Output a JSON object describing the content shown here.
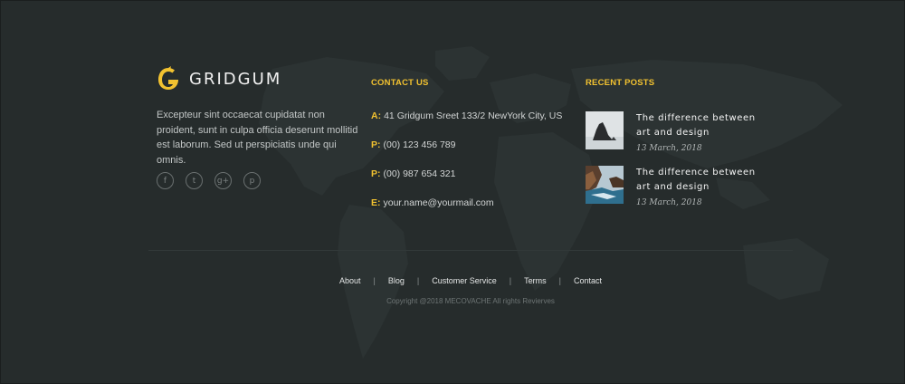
{
  "brand": {
    "name": "GRIDGUM",
    "accent": "#f2c230"
  },
  "about": {
    "text": "Excepteur sint occaecat cupidatat non proident, sunt in culpa officia deserunt mollitid est laborum. Sed ut perspiciatis unde qui omnis."
  },
  "socials": [
    {
      "icon": "facebook-icon",
      "glyph": "f"
    },
    {
      "icon": "twitter-icon",
      "glyph": "t"
    },
    {
      "icon": "google-plus-icon",
      "glyph": "g+"
    },
    {
      "icon": "pinterest-icon",
      "glyph": "p"
    }
  ],
  "contact": {
    "title": "CONTACT US",
    "address": {
      "label": "A:",
      "value": "41 Gridgum Sreet 133/2 NewYork City, US"
    },
    "phone1": {
      "label": "P:",
      "value": "(00) 123 456 789"
    },
    "phone2": {
      "label": "P:",
      "value": "(00) 987 654 321"
    },
    "email": {
      "label": "E:",
      "value": "your.name@yourmail.com"
    }
  },
  "recent_posts": {
    "title": "RECENT POSTS",
    "items": [
      {
        "title": "The difference between art and design",
        "date": "13 March, 2018"
      },
      {
        "title": "The difference between art and design",
        "date": "13 March, 2018"
      }
    ]
  },
  "footer_nav": {
    "about": "About",
    "blog": "Blog",
    "customer_service": "Customer Service",
    "terms": "Terms",
    "contact": "Contact",
    "separator": "|"
  },
  "copyright": "Copyright @2018 MECOVACHE All rights Revierves"
}
